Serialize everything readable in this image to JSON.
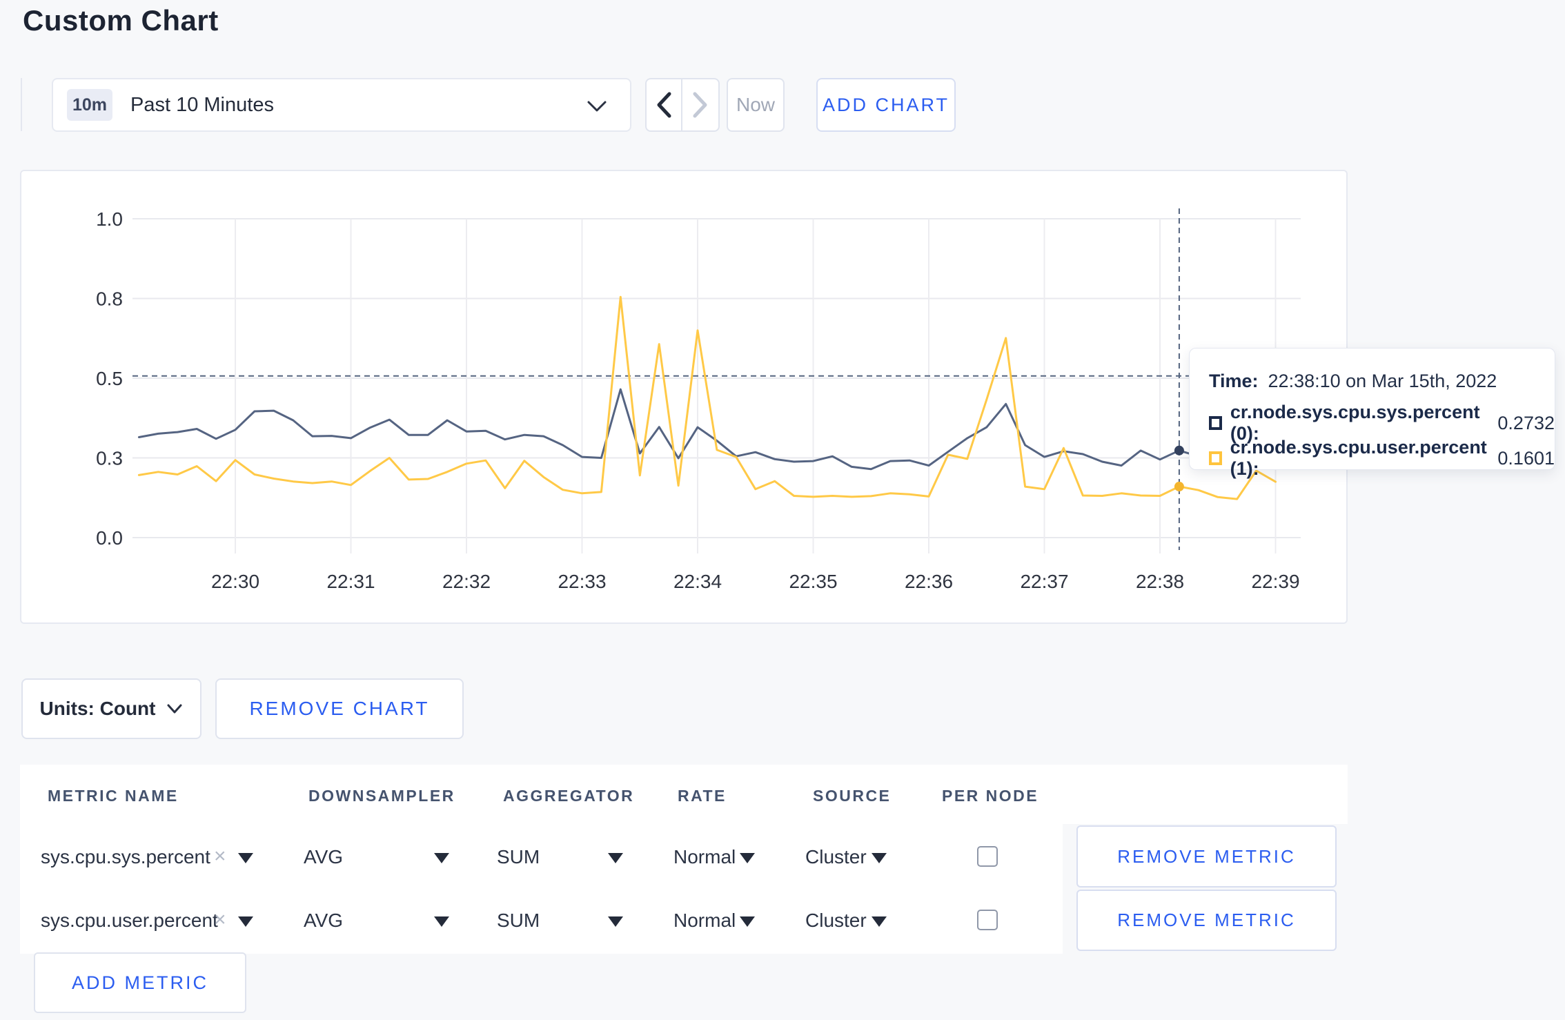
{
  "page": {
    "title": "Custom Chart"
  },
  "colors": {
    "accent_blue": "#2b5df0",
    "series_sys": "#556482",
    "series_user": "#ffc947",
    "swatch_sys": "#1b2a49",
    "swatch_user": "#ffc43d"
  },
  "toolbar": {
    "time_badge": "10m",
    "time_label": "Past 10 Minutes",
    "now_label": "Now",
    "add_chart_label": "ADD CHART"
  },
  "chart": {
    "tooltip": {
      "time_label": "Time:",
      "time_value": "22:38:10 on Mar 15th, 2022",
      "series": [
        {
          "label": "cr.node.sys.cpu.sys.percent (0):",
          "value": "0.2732",
          "swatch": "#1b2a49"
        },
        {
          "label": "cr.node.sys.cpu.user.percent (1):",
          "value": "0.1601",
          "swatch": "#ffc43d"
        }
      ]
    }
  },
  "chart_data": {
    "type": "line",
    "title": "",
    "xlabel": "",
    "ylabel": "",
    "ylim": [
      0,
      1
    ],
    "grid": true,
    "x_ticks": [
      "22:30",
      "22:31",
      "22:32",
      "22:33",
      "22:34",
      "22:35",
      "22:36",
      "22:37",
      "22:38",
      "22:39"
    ],
    "y_ticks": [
      "1.0",
      "0.8",
      "0.5",
      "0.3",
      "0.0"
    ],
    "y_tick_values": [
      1.0,
      0.75,
      0.5,
      0.25,
      0.0
    ],
    "x_start_seconds": -50,
    "x_step_seconds": 10,
    "hover_crosshair": {
      "x_seconds": 490,
      "y_value": 0.507,
      "time": "22:38:10"
    },
    "series": [
      {
        "name": "cr.node.sys.cpu.sys.percent",
        "color": "#556482",
        "dot_color": "#33415e",
        "values": [
          0.315,
          0.326,
          0.331,
          0.341,
          0.31,
          0.338,
          0.396,
          0.398,
          0.368,
          0.318,
          0.319,
          0.312,
          0.345,
          0.37,
          0.322,
          0.322,
          0.368,
          0.333,
          0.335,
          0.308,
          0.322,
          0.318,
          0.29,
          0.253,
          0.25,
          0.465,
          0.264,
          0.347,
          0.249,
          0.346,
          0.304,
          0.255,
          0.268,
          0.246,
          0.238,
          0.24,
          0.255,
          0.222,
          0.215,
          0.24,
          0.242,
          0.226,
          0.269,
          0.312,
          0.346,
          0.419,
          0.29,
          0.253,
          0.271,
          0.262,
          0.238,
          0.226,
          0.273,
          0.245,
          0.2732,
          0.255,
          0.262,
          0.25,
          0.258,
          0.25
        ]
      },
      {
        "name": "cr.node.sys.cpu.user.percent",
        "color": "#ffc947",
        "dot_color": "#f4b52e",
        "values": [
          0.196,
          0.206,
          0.198,
          0.224,
          0.177,
          0.243,
          0.198,
          0.185,
          0.176,
          0.171,
          0.176,
          0.165,
          0.209,
          0.25,
          0.182,
          0.184,
          0.206,
          0.232,
          0.242,
          0.155,
          0.241,
          0.19,
          0.15,
          0.139,
          0.143,
          0.755,
          0.195,
          0.607,
          0.163,
          0.65,
          0.275,
          0.253,
          0.152,
          0.177,
          0.131,
          0.128,
          0.131,
          0.128,
          0.13,
          0.139,
          0.136,
          0.129,
          0.26,
          0.247,
          0.433,
          0.626,
          0.16,
          0.152,
          0.281,
          0.132,
          0.131,
          0.139,
          0.132,
          0.131,
          0.1601,
          0.149,
          0.127,
          0.121,
          0.21,
          0.175
        ]
      }
    ]
  },
  "units_bar": {
    "units_label": "Units: Count",
    "remove_chart_label": "REMOVE CHART"
  },
  "metrics_table": {
    "headers": [
      "METRIC NAME",
      "DOWNSAMPLER",
      "AGGREGATOR",
      "RATE",
      "SOURCE",
      "PER NODE"
    ],
    "clear_icon": "×",
    "rows": [
      {
        "metric": "sys.cpu.sys.percent",
        "downsampler": "AVG",
        "aggregator": "SUM",
        "rate": "Normal",
        "source": "Cluster",
        "per_node_checked": false,
        "remove_label": "REMOVE METRIC"
      },
      {
        "metric": "sys.cpu.user.percent",
        "downsampler": "AVG",
        "aggregator": "SUM",
        "rate": "Normal",
        "source": "Cluster",
        "per_node_checked": false,
        "remove_label": "REMOVE METRIC"
      }
    ],
    "add_metric_label": "ADD METRIC"
  }
}
